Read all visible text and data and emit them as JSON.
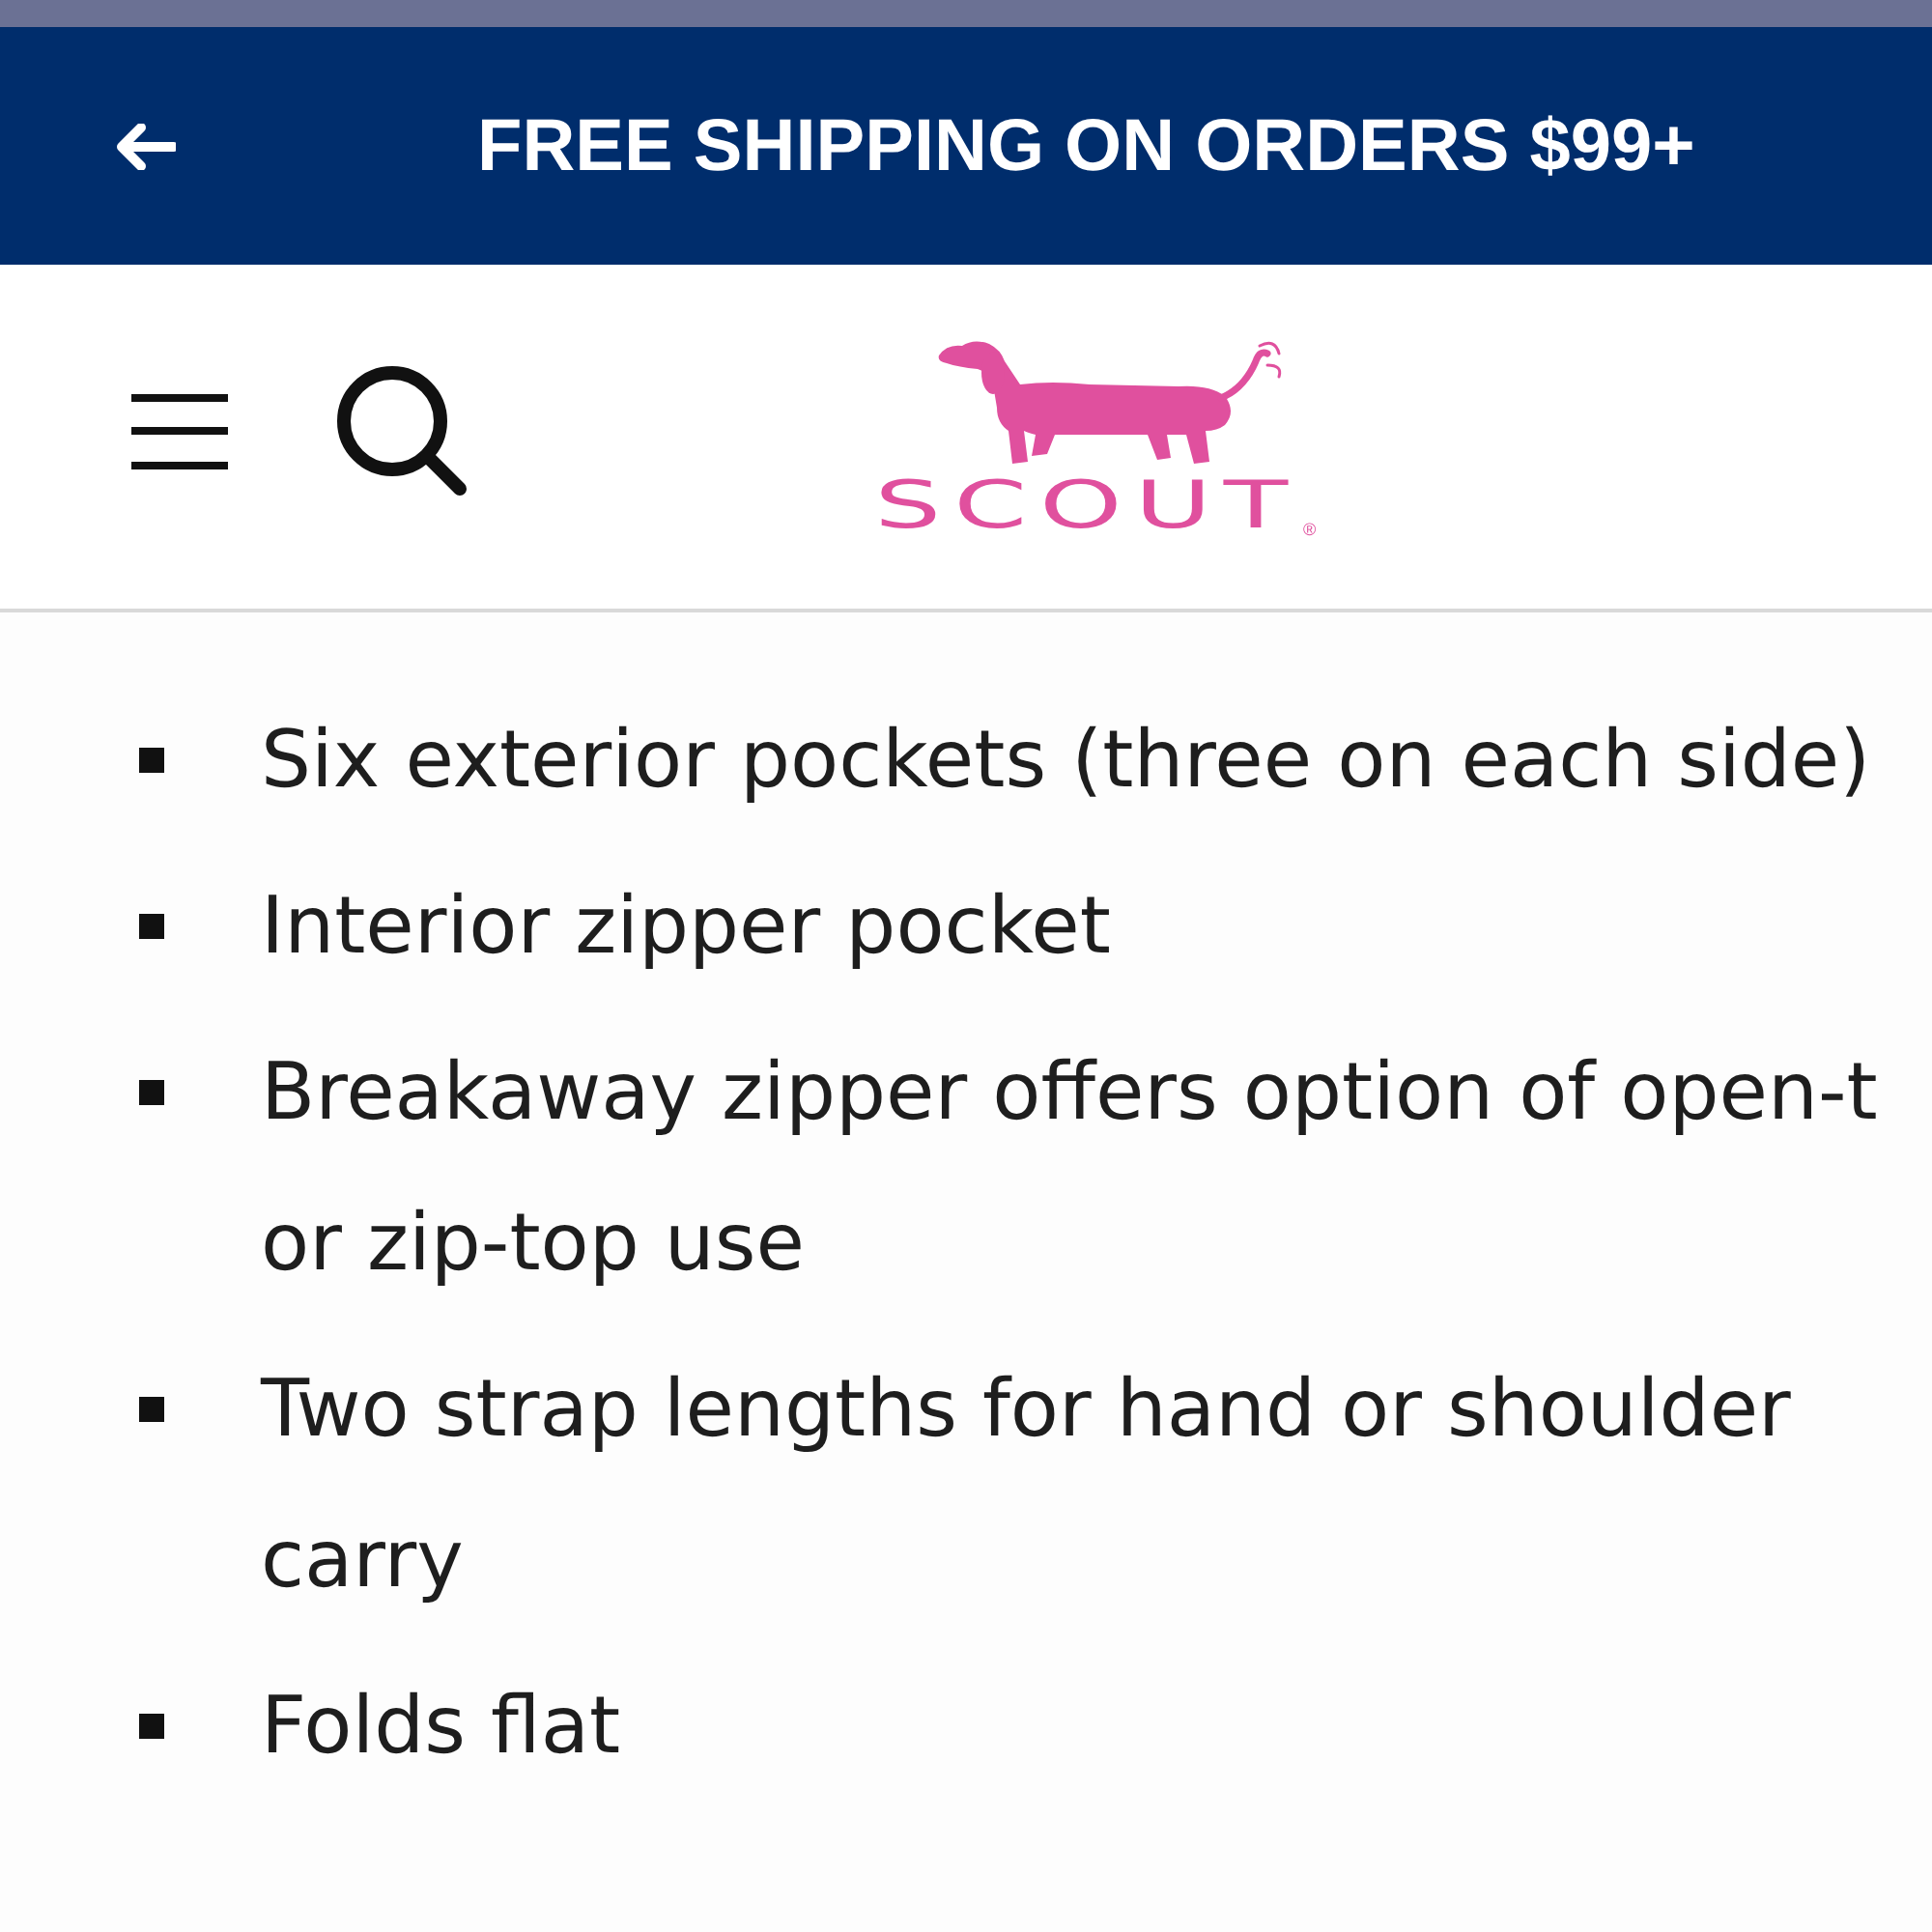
{
  "banner": {
    "text": "FREE SHIPPING ON ORDERS $99+"
  },
  "header": {
    "logo": {
      "wordmark": "SCOUT",
      "mark": "®"
    }
  },
  "features": [
    {
      "lines": [
        "Six exterior pockets (three on each side)"
      ]
    },
    {
      "lines": [
        "Interior zipper pocket"
      ]
    },
    {
      "lines": [
        "Breakaway zipper offers option of open-t",
        "or zip-top use"
      ]
    },
    {
      "lines": [
        "Two strap lengths for hand or shoulder",
        "carry"
      ]
    },
    {
      "lines": [
        "Folds flat"
      ]
    }
  ]
}
